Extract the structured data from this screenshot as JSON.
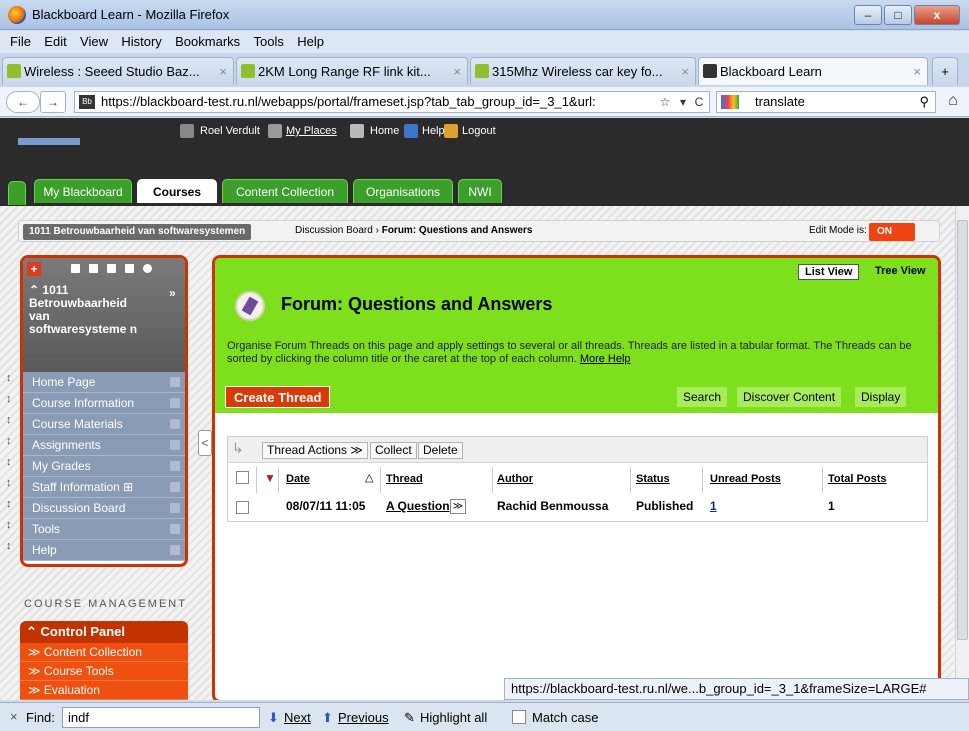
{
  "window": {
    "title": "Blackboard Learn - Mozilla Firefox",
    "min": "–",
    "max": "□",
    "close": "x"
  },
  "menubar": [
    "File",
    "Edit",
    "View",
    "History",
    "Bookmarks",
    "Tools",
    "Help"
  ],
  "browser_tabs": [
    {
      "label": "Wireless : Seeed Studio Baz...",
      "close": "×"
    },
    {
      "label": "2KM Long Range RF link kit...",
      "close": "×"
    },
    {
      "label": "315Mhz Wireless car key fo...",
      "close": "×"
    },
    {
      "label": "Blackboard Learn",
      "close": "×"
    }
  ],
  "new_tab": "+",
  "nav": {
    "back": "←",
    "forward": "→",
    "url": "https://blackboard-test.ru.nl/webapps/portal/frameset.jsp?tab_tab_group_id=_3_1&url:",
    "star": "☆",
    "dropdown": "▾",
    "reload": "C",
    "search_value": "translate",
    "search_icon": "⚲",
    "home": "⌂",
    "site_badge": "Bb"
  },
  "bb_header": {
    "user": "Roel Verdult",
    "my_places": "My Places",
    "home": "Home",
    "help": "Help",
    "logout": "Logout"
  },
  "course_tabs": [
    "My Blackboard",
    "Courses",
    "Content Collection",
    "Organisations",
    "NWI"
  ],
  "breadcrumb": {
    "course": "1011 Betrouwbaarheid van softwaresystemen",
    "parent": "Discussion Board",
    "sep": "›",
    "current": "Forum: Questions and Answers",
    "edit_label": "Edit Mode is:",
    "edit_value": "ON"
  },
  "course_menu": {
    "plus": "+",
    "collapse": "»",
    "course_name": "⌃ 1011 Betrouwbaarheid van softwaresysteme n",
    "items": [
      "Home Page",
      "Course Information",
      "Course Materials",
      "Assignments",
      "My Grades",
      "Staff Information ⊞",
      "Discussion Board",
      "Tools",
      "Help"
    ]
  },
  "collapse_arrow": "<",
  "course_management": {
    "title": "COURSE MANAGEMENT",
    "control_panel": "⌃ Control Panel",
    "items": [
      "≫ Content Collection",
      "≫ Course Tools",
      "≫ Evaluation"
    ]
  },
  "forum": {
    "list_view": "List View",
    "tree_view": "Tree View",
    "title": "Forum: Questions and Answers",
    "description": "Organise Forum Threads on this page and apply settings to several or all threads. Threads are listed in a tabular format. The Threads can be sorted by clicking the column title or the caret at the top of each column.",
    "more_help": "More Help",
    "create_thread": "Create Thread",
    "search": "Search",
    "discover": "Discover Content",
    "display": "Display"
  },
  "grid": {
    "actions": [
      "Thread Actions ≫",
      "Collect",
      "Delete"
    ],
    "columns": [
      "Date",
      "Thread",
      "Author",
      "Status",
      "Unread Posts",
      "Total Posts"
    ],
    "sort_indicator": "△",
    "rows": [
      {
        "date": "08/07/11 11:05",
        "thread": "A Question",
        "author": "Rachid Benmoussa",
        "status": "Published",
        "unread": "1",
        "total": "1"
      }
    ]
  },
  "status_url": "https://blackboard-test.ru.nl/we...b_group_id=_3_1&frameSize=LARGE#",
  "findbar": {
    "close": "×",
    "label": "Find:",
    "value": "indf",
    "next": "Next",
    "previous": "Previous",
    "highlight": "Highlight all",
    "match_case": "Match case"
  }
}
